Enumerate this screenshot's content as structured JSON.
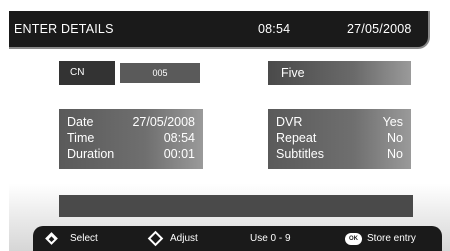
{
  "header": {
    "title": "ENTER DETAILS",
    "time": "08:54",
    "date": "27/05/2008"
  },
  "channel": {
    "label": "CN",
    "value": "005",
    "name": "Five"
  },
  "details": {
    "left": [
      {
        "label": "Date",
        "value": "27/05/2008"
      },
      {
        "label": "Time",
        "value": "08:54"
      },
      {
        "label": "Duration",
        "value": "00:01"
      }
    ],
    "right": [
      {
        "label": "DVR",
        "value": "Yes"
      },
      {
        "label": "Repeat",
        "value": "No"
      },
      {
        "label": "Subtitles",
        "value": "No"
      }
    ]
  },
  "footer": {
    "select": "Select",
    "adjust": "Adjust",
    "use": "Use 0 - 9",
    "ok_glyph": "OK",
    "store": "Store entry"
  },
  "icons": {
    "select": "select-diamond-icon",
    "adjust": "adjust-diamond-icon",
    "ok": "ok-button-icon"
  }
}
